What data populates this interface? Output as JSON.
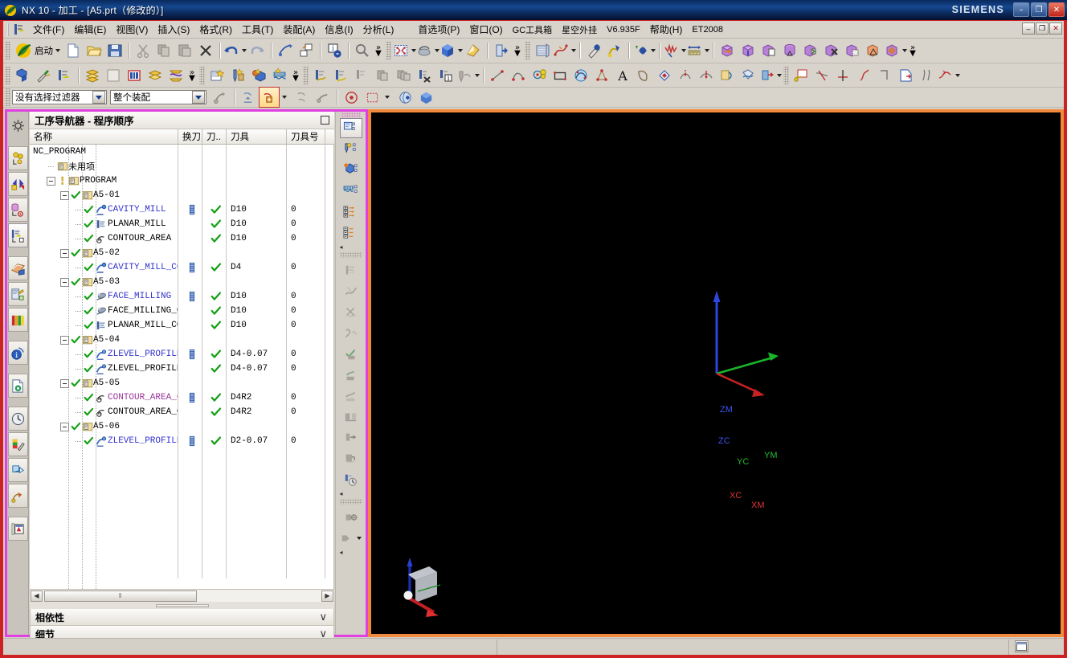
{
  "window": {
    "title": "NX 10 - 加工 - [A5.prt（修改的）]",
    "brand": "SIEMENS",
    "app_icon": "nx-logo-icon",
    "buttons": [
      {
        "name": "minimize-button",
        "glyph": "–"
      },
      {
        "name": "maximize-button",
        "glyph": "❐"
      },
      {
        "name": "close-button",
        "glyph": "✕"
      }
    ]
  },
  "menubar": {
    "items": [
      {
        "label": "文件(F)",
        "name": "menu-file"
      },
      {
        "label": "编辑(E)",
        "name": "menu-edit"
      },
      {
        "label": "视图(V)",
        "name": "menu-view"
      },
      {
        "label": "插入(S)",
        "name": "menu-insert"
      },
      {
        "label": "格式(R)",
        "name": "menu-format"
      },
      {
        "label": "工具(T)",
        "name": "menu-tools"
      },
      {
        "label": "装配(A)",
        "name": "menu-assembly"
      },
      {
        "label": "信息(I)",
        "name": "menu-info"
      },
      {
        "label": "分析(L)",
        "name": "menu-analysis"
      },
      {
        "label": "首选项(P)",
        "name": "menu-preferences"
      },
      {
        "label": "窗口(O)",
        "name": "menu-window"
      },
      {
        "label": "GC工具箱",
        "name": "menu-gc-toolbox"
      },
      {
        "label": "星空外挂",
        "name": "menu-plugin"
      },
      {
        "label": "V6.935F",
        "name": "menu-plugin-version"
      },
      {
        "label": "帮助(H)",
        "name": "menu-help"
      },
      {
        "label": "ET2008",
        "name": "menu-et2008"
      }
    ],
    "window_buttons": [
      {
        "name": "mdi-minimize-button",
        "glyph": "–"
      },
      {
        "name": "mdi-restore-button",
        "glyph": "❐"
      },
      {
        "name": "mdi-close-button",
        "glyph": "✕"
      }
    ]
  },
  "toolbar_standard": {
    "start_label": "启动"
  },
  "selection_bar": {
    "filter": {
      "value": "没有选择过滤器",
      "name": "selection-filter-combo"
    },
    "scope": {
      "value": "整个装配",
      "name": "selection-scope-combo"
    }
  },
  "resource_bar": {
    "items": [
      {
        "name": "resource-settings-icon",
        "selected": false
      },
      {
        "name": "resource-assembly-navigator",
        "selected": false
      },
      {
        "name": "resource-part-navigator",
        "selected": false
      },
      {
        "name": "resource-reuse-library",
        "selected": false
      },
      {
        "name": "resource-operation-navigator",
        "selected": true
      },
      {
        "name": "resource-web-browser",
        "selected": false
      },
      {
        "name": "resource-history",
        "selected": false
      },
      {
        "name": "resource-role-library",
        "selected": false
      },
      {
        "name": "resource-info-window",
        "selected": false
      },
      {
        "name": "resource-process-studio",
        "selected": false
      },
      {
        "name": "resource-hd3d-tools",
        "selected": false
      },
      {
        "name": "resource-system-scene",
        "selected": false
      },
      {
        "name": "resource-system-materials",
        "selected": false
      },
      {
        "name": "resource-system-visualization",
        "selected": false
      },
      {
        "name": "resource-manufacturing-wizards",
        "selected": false
      }
    ]
  },
  "navigator": {
    "title": "工序导航器 - 程序顺序",
    "maximize_name": "navigator-maximize-button",
    "columns": [
      {
        "label": "名称",
        "name": "column-name",
        "width": 185
      },
      {
        "label": "换刀",
        "name": "column-tool-change",
        "width": 30
      },
      {
        "label": "刀..",
        "name": "column-tool-path",
        "width": 30
      },
      {
        "label": "刀具",
        "name": "column-tool",
        "width": 75
      },
      {
        "label": "刀具号",
        "name": "column-tool-number",
        "width": 48
      }
    ],
    "rows": [
      {
        "name": "NC_PROGRAM",
        "depth": 0,
        "kind": "root",
        "icon": "none",
        "color": "black",
        "expander": "none",
        "check": "none",
        "tool_change": false,
        "path_ok": false,
        "tool": "",
        "tool_no": ""
      },
      {
        "name": "未用项",
        "depth": 1,
        "kind": "group",
        "icon": "program-folder-icon",
        "color": "black",
        "expander": "none",
        "check": "none",
        "tool_change": false,
        "path_ok": false,
        "tool": "",
        "tool_no": ""
      },
      {
        "name": "PROGRAM",
        "depth": 1,
        "kind": "group",
        "icon": "program-folder-icon",
        "color": "black",
        "expander": "minus",
        "check": "warn",
        "tool_change": false,
        "path_ok": false,
        "tool": "",
        "tool_no": ""
      },
      {
        "name": "A5-01",
        "depth": 2,
        "kind": "group",
        "icon": "program-folder-icon",
        "color": "black",
        "expander": "minus",
        "check": "ok",
        "tool_change": false,
        "path_ok": false,
        "tool": "",
        "tool_no": ""
      },
      {
        "name": "CAVITY_MILL",
        "depth": 3,
        "kind": "operation",
        "icon": "cavity-mill-icon",
        "color": "blue",
        "expander": "none",
        "check": "ok",
        "tool_change": true,
        "path_ok": true,
        "tool": "D10",
        "tool_no": "0"
      },
      {
        "name": "PLANAR_MILL",
        "depth": 3,
        "kind": "operation",
        "icon": "planar-mill-icon",
        "color": "black",
        "expander": "none",
        "check": "ok",
        "tool_change": false,
        "path_ok": true,
        "tool": "D10",
        "tool_no": "0"
      },
      {
        "name": "CONTOUR_AREA",
        "depth": 3,
        "kind": "operation",
        "icon": "contour-area-icon",
        "color": "black",
        "expander": "none",
        "check": "ok",
        "tool_change": false,
        "path_ok": true,
        "tool": "D10",
        "tool_no": "0"
      },
      {
        "name": "A5-02",
        "depth": 2,
        "kind": "group",
        "icon": "program-folder-icon",
        "color": "black",
        "expander": "minus",
        "check": "ok",
        "tool_change": false,
        "path_ok": false,
        "tool": "",
        "tool_no": ""
      },
      {
        "name": "CAVITY_MILL_COPY",
        "depth": 3,
        "kind": "operation",
        "icon": "cavity-mill-icon",
        "color": "blue",
        "expander": "none",
        "check": "ok",
        "tool_change": true,
        "path_ok": true,
        "tool": "D4",
        "tool_no": "0"
      },
      {
        "name": "A5-03",
        "depth": 2,
        "kind": "group",
        "icon": "program-folder-icon",
        "color": "black",
        "expander": "minus",
        "check": "ok",
        "tool_change": false,
        "path_ok": false,
        "tool": "",
        "tool_no": ""
      },
      {
        "name": "FACE_MILLING",
        "depth": 3,
        "kind": "operation",
        "icon": "face-milling-icon",
        "color": "blue",
        "expander": "none",
        "check": "ok",
        "tool_change": true,
        "path_ok": true,
        "tool": "D10",
        "tool_no": "0"
      },
      {
        "name": "FACE_MILLING_COPY",
        "depth": 3,
        "kind": "operation",
        "icon": "face-milling-icon",
        "color": "black",
        "expander": "none",
        "check": "ok",
        "tool_change": false,
        "path_ok": true,
        "tool": "D10",
        "tool_no": "0"
      },
      {
        "name": "PLANAR_MILL_COPY",
        "depth": 3,
        "kind": "operation",
        "icon": "planar-mill-icon",
        "color": "black",
        "expander": "none",
        "check": "ok",
        "tool_change": false,
        "path_ok": true,
        "tool": "D10",
        "tool_no": "0"
      },
      {
        "name": "A5-04",
        "depth": 2,
        "kind": "group",
        "icon": "program-folder-icon",
        "color": "black",
        "expander": "minus",
        "check": "ok",
        "tool_change": false,
        "path_ok": false,
        "tool": "",
        "tool_no": ""
      },
      {
        "name": "ZLEVEL_PROFILE",
        "depth": 3,
        "kind": "operation",
        "icon": "zlevel-profile-icon",
        "color": "blue",
        "expander": "none",
        "check": "ok",
        "tool_change": true,
        "path_ok": true,
        "tool": "D4-0.07",
        "tool_no": "0"
      },
      {
        "name": "ZLEVEL_PROFILE...",
        "depth": 3,
        "kind": "operation",
        "icon": "zlevel-profile-icon",
        "color": "black",
        "expander": "none",
        "check": "ok",
        "tool_change": false,
        "path_ok": true,
        "tool": "D4-0.07",
        "tool_no": "0"
      },
      {
        "name": "A5-05",
        "depth": 2,
        "kind": "group",
        "icon": "program-folder-icon",
        "color": "black",
        "expander": "minus",
        "check": "ok",
        "tool_change": false,
        "path_ok": false,
        "tool": "",
        "tool_no": ""
      },
      {
        "name": "CONTOUR_AREA_COPY",
        "depth": 3,
        "kind": "operation",
        "icon": "contour-area-icon",
        "color": "purple",
        "expander": "none",
        "check": "ok",
        "tool_change": true,
        "path_ok": true,
        "tool": "D4R2",
        "tool_no": "0"
      },
      {
        "name": "CONTOUR_AREA_C...",
        "depth": 3,
        "kind": "operation",
        "icon": "contour-area-icon",
        "color": "black",
        "expander": "none",
        "check": "ok",
        "tool_change": false,
        "path_ok": true,
        "tool": "D4R2",
        "tool_no": "0"
      },
      {
        "name": "A5-06",
        "depth": 2,
        "kind": "group",
        "icon": "program-folder-icon",
        "color": "black",
        "expander": "minus",
        "check": "ok",
        "tool_change": false,
        "path_ok": false,
        "tool": "",
        "tool_no": ""
      },
      {
        "name": "ZLEVEL_PROFILE...",
        "depth": 3,
        "kind": "operation",
        "icon": "zlevel-profile-icon",
        "color": "blue",
        "expander": "none",
        "check": "ok",
        "tool_change": true,
        "path_ok": true,
        "tool": "D2-0.07",
        "tool_no": "0"
      }
    ],
    "hscroll": {
      "left_arrow": "◀",
      "right_arrow": "▶",
      "thumb_glyph": "‖"
    },
    "panels": [
      {
        "label": "相依性",
        "name": "panel-dependencies",
        "chevron": "∨"
      },
      {
        "label": "细节",
        "name": "panel-details",
        "chevron": "∨"
      }
    ]
  },
  "viewport": {
    "background": "#000000",
    "wcs_triad": {
      "labels": [
        {
          "text": "ZM",
          "color": "#4466ff",
          "name": "axis-label-zm"
        },
        {
          "text": "ZC",
          "color": "#4466ff",
          "name": "axis-label-zc"
        },
        {
          "text": "YM",
          "color": "#22bb33",
          "name": "axis-label-ym"
        },
        {
          "text": "YC",
          "color": "#22bb33",
          "name": "axis-label-yc"
        },
        {
          "text": "XM",
          "color": "#cc2222",
          "name": "axis-label-xm"
        },
        {
          "text": "XC",
          "color": "#cc2222",
          "name": "axis-label-xc"
        }
      ]
    },
    "corner_triad": {
      "name": "view-orientation-cube"
    }
  },
  "statusbar": {
    "message": "",
    "icon_name": "status-window-icon"
  },
  "colors": {
    "title_gradient_start": "#15488f",
    "red_frame": "#cc2222",
    "pink_frame": "#e040e0",
    "orange_frame": "#f08a3c",
    "tree_blue": "#3333cc",
    "tree_purple": "#993399",
    "check_green": "#14a014"
  }
}
